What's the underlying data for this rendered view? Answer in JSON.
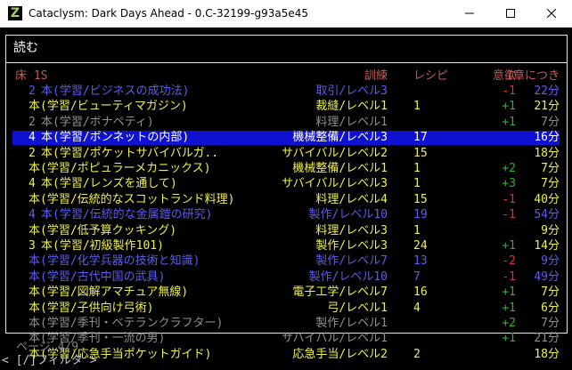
{
  "window": {
    "title": "Cataclysm: Dark Days Ahead - 0.C-32199-g93a5e45",
    "icon_letter": "Z"
  },
  "menu": {
    "title": "読む"
  },
  "header": {
    "floor": "床 1S",
    "skill": "訓練",
    "recipe": "レシピ",
    "fun": "意欲",
    "time": "1章につき"
  },
  "colors": {
    "yellow": "#f0f04a",
    "blue": "#5c5cf0",
    "gray": "#909090",
    "white": "#ffffff",
    "red": "#e03030",
    "green": "#30b030",
    "selection": "#1010d0"
  },
  "rows": [
    {
      "idx": "2",
      "name": "本(学習/ビジネスの成功法)",
      "skill": "取引/レベル3",
      "recipe": "",
      "fun": "-1",
      "time": "22分",
      "color": "blue",
      "fun_color": "red"
    },
    {
      "idx": "",
      "name": "本(学習/ビューティマガジン)",
      "skill": "裁縫/レベル1",
      "recipe": "1",
      "fun": "+1",
      "time": "21分",
      "color": "yellow",
      "fun_color": "green"
    },
    {
      "idx": "2",
      "name": "本(学習/ボナペティ)",
      "skill": "料理/レベル1",
      "recipe": "",
      "fun": "+1",
      "time": "7分",
      "color": "gray",
      "fun_color": "green"
    },
    {
      "idx": "4",
      "name": "本(学習/ボンネットの内部)",
      "skill": "機械整備/レベル3",
      "recipe": "17",
      "fun": "",
      "time": "16分",
      "color": "white",
      "fun_color": "white",
      "selected": true
    },
    {
      "idx": "2",
      "name": "本(学習/ポケットサバイバルガ..",
      "skill": "サバイバル/レベル2",
      "recipe": "15",
      "fun": "",
      "time": "18分",
      "color": "yellow",
      "fun_color": "white"
    },
    {
      "idx": "",
      "name": "本(学習/ポピュラーメカニックス)",
      "skill": "機械整備/レベル1",
      "recipe": "1",
      "fun": "+2",
      "time": "7分",
      "color": "yellow",
      "fun_color": "green"
    },
    {
      "idx": "4",
      "name": "本(学習/レンズを通して)",
      "skill": "サバイバル/レベル3",
      "recipe": "1",
      "fun": "+3",
      "time": "7分",
      "color": "yellow",
      "fun_color": "green"
    },
    {
      "idx": "",
      "name": "本(学習/伝統的なスコットランド料理)",
      "skill": "料理/レベル4",
      "recipe": "15",
      "fun": "-1",
      "time": "40分",
      "color": "yellow",
      "fun_color": "red"
    },
    {
      "idx": "4",
      "name": "本(学習/伝統的な金属鎧の研究)",
      "skill": "製作/レベル10",
      "recipe": "19",
      "fun": "-1",
      "time": "54分",
      "color": "blue",
      "fun_color": "red"
    },
    {
      "idx": "",
      "name": "本(学習/低予算クッキング)",
      "skill": "料理/レベル3",
      "recipe": "1",
      "fun": "",
      "time": "9分",
      "color": "yellow",
      "fun_color": "white"
    },
    {
      "idx": "3",
      "name": "本(学習/初級製作101)",
      "skill": "製作/レベル3",
      "recipe": "24",
      "fun": "+1",
      "time": "14分",
      "color": "yellow",
      "fun_color": "green"
    },
    {
      "idx": "",
      "name": "本(学習/化学兵器の技術と知識)",
      "skill": "製作/レベル7",
      "recipe": "13",
      "fun": "-2",
      "time": "9分",
      "color": "blue",
      "fun_color": "red"
    },
    {
      "idx": "",
      "name": "本(学習/古代中国の武具)",
      "skill": "製作/レベル10",
      "recipe": "7",
      "fun": "-1",
      "time": "49分",
      "color": "blue",
      "fun_color": "red"
    },
    {
      "idx": "",
      "name": "本(学習/図解アマチュア無線)",
      "skill": "電子工学/レベル7",
      "recipe": "16",
      "fun": "+1",
      "time": "7分",
      "color": "yellow",
      "fun_color": "green"
    },
    {
      "idx": "",
      "name": "本(学習/子供向け弓術)",
      "skill": "弓/レベル1",
      "recipe": "4",
      "fun": "+1",
      "time": "6分",
      "color": "yellow",
      "fun_color": "green"
    },
    {
      "idx": "",
      "name": "本(学習/季刊・ベテランクラフター)",
      "skill": "製作/レベル1",
      "recipe": "",
      "fun": "+2",
      "time": "7分",
      "color": "gray",
      "fun_color": "green"
    },
    {
      "idx": "",
      "name": "本(学習/季刊・一流の男)",
      "skill": "サバイバル/レベル1",
      "recipe": "",
      "fun": "+1",
      "time": "21分",
      "color": "gray",
      "fun_color": "green"
    },
    {
      "idx": "",
      "name": "本(学習/応急手当ポケットガイド)",
      "skill": "応急手当/レベル2",
      "recipe": "2",
      "fun": "",
      "time": "18分",
      "color": "yellow",
      "fun_color": "white"
    }
  ],
  "footer": {
    "page": "ページ 4/9",
    "filter": "< [/]フィルタ >"
  }
}
